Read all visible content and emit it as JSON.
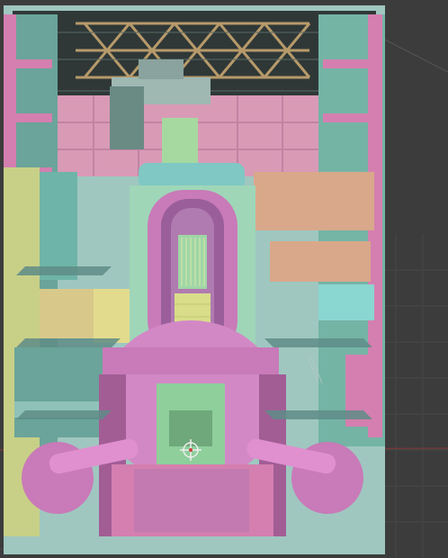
{
  "viewport": {
    "background": "#3c3c3c",
    "grid_color": "#4a4a4a",
    "axis_x_color": "#9b3b3b",
    "axis_y_color": "#5b8a3b"
  },
  "model": {
    "subject": "reactor-building-cutaway",
    "palette": {
      "pink": "#e89ad0",
      "magenta": "#c97ab8",
      "teal": "#7fc8c4",
      "cyan": "#8ad6d0",
      "green": "#9fd6a6",
      "yellow": "#e8df8a",
      "tan": "#d9a88a",
      "olive": "#b9c98a",
      "steel": "#8fb0b8",
      "dark": "#2a2f2f"
    }
  },
  "gizmo": {
    "icon": "crosshair-gizmo-icon"
  }
}
